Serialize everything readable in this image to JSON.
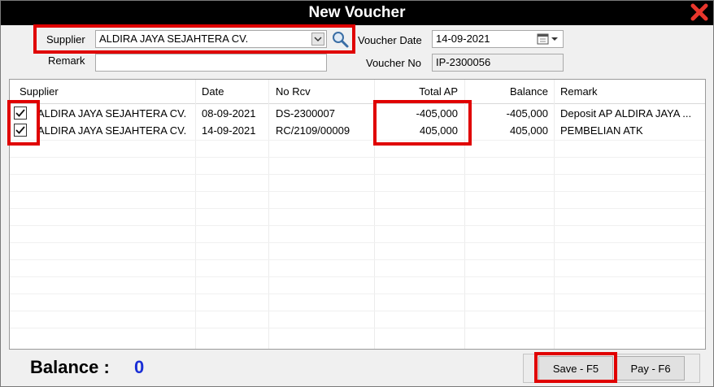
{
  "window": {
    "title": "New Voucher"
  },
  "form": {
    "supplier_label": "Supplier",
    "supplier_value": "ALDIRA JAYA SEJAHTERA CV.",
    "remark_label": "Remark",
    "remark_value": "",
    "voucher_date_label": "Voucher Date",
    "voucher_date_value": "14-09-2021",
    "voucher_no_label": "Voucher No",
    "voucher_no_value": "IP-2300056"
  },
  "grid": {
    "columns": [
      "Supplier",
      "Date",
      "No Rcv",
      "Total AP",
      "Balance",
      "Remark"
    ],
    "rows": [
      {
        "checked": true,
        "supplier": "ALDIRA JAYA SEJAHTERA CV.",
        "date": "08-09-2021",
        "no_rcv": "DS-2300007",
        "total_ap": "-405,000",
        "balance": "-405,000",
        "remark": "Deposit AP ALDIRA JAYA ..."
      },
      {
        "checked": true,
        "supplier": "ALDIRA JAYA SEJAHTERA CV.",
        "date": "14-09-2021",
        "no_rcv": "RC/2109/00009",
        "total_ap": "405,000",
        "balance": "405,000",
        "remark": "PEMBELIAN ATK"
      }
    ]
  },
  "footer": {
    "balance_label": "Balance :",
    "balance_value": "0",
    "save_label": "Save - F5",
    "pay_label": "Pay - F6"
  },
  "colors": {
    "highlight": "#e00000",
    "balance_value": "#1a2fd6",
    "titlebar": "#000000"
  },
  "icons": {
    "close": "close-x-icon",
    "search": "magnifier-icon",
    "calendar": "calendar-icon",
    "dropdown": "chevron-down-icon"
  }
}
